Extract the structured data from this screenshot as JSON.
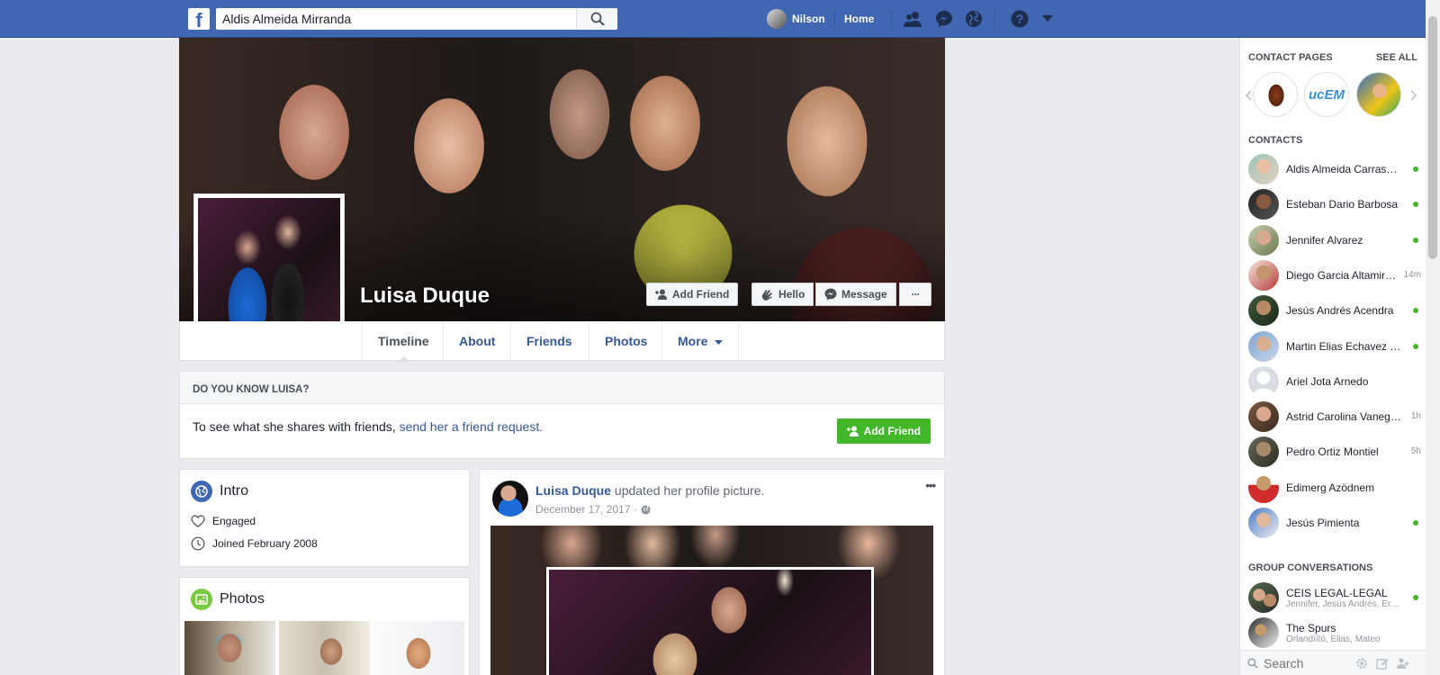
{
  "topbar": {
    "logo": "f",
    "search_value": "Aldis Almeida Mirranda",
    "user_name": "Nilson",
    "home_label": "Home",
    "icons": [
      "friend-requests-icon",
      "messages-icon",
      "notifications-globe-icon",
      "help-icon",
      "caret-down-icon"
    ],
    "brand_color": "#4267b2"
  },
  "profile": {
    "name": "Luisa Duque",
    "add_friend_label": "Add Friend",
    "hello_label": "Hello",
    "message_label": "Message",
    "more_dots": "···"
  },
  "tabs": {
    "timeline": "Timeline",
    "about": "About",
    "friends": "Friends",
    "photos": "Photos",
    "more": "More"
  },
  "know": {
    "heading": "DO YOU KNOW LUISA?",
    "text": "To see what she shares with friends,",
    "link": "send her a friend request.",
    "button": "Add Friend"
  },
  "intro": {
    "title": "Intro",
    "engaged": "Engaged",
    "joined": "Joined February 2008"
  },
  "photos_card": {
    "title": "Photos"
  },
  "post": {
    "author": "Luisa Duque",
    "action": "updated her profile picture.",
    "date": "December 17, 2017 ·",
    "menu": "•••"
  },
  "sidebar": {
    "contact_pages_label": "CONTACT PAGES",
    "see_all": "SEE ALL",
    "pages": [
      "page-1-logo",
      "ucem-logo",
      "page-3-logo"
    ],
    "ucem_text": "ucEM",
    "contacts_label": "CONTACTS",
    "contacts": [
      {
        "name": "Aldis Almeida Carrasquilla",
        "status": "",
        "online": true
      },
      {
        "name": "Esteban Dario Barbosa",
        "status": "",
        "online": true
      },
      {
        "name": "Jennifer Alvarez",
        "status": "",
        "online": true
      },
      {
        "name": "Diego Garcia Altamiranda",
        "status": "14m",
        "online": false
      },
      {
        "name": "Jesús Andrés Acendra",
        "status": "",
        "online": true
      },
      {
        "name": "Martin Elias Echavez Romero",
        "status": "",
        "online": true
      },
      {
        "name": "Ariel Jota Arnedo",
        "status": "",
        "online": false
      },
      {
        "name": "Astrid Carolina Vanegas",
        "status": "1h",
        "online": false
      },
      {
        "name": "Pedro Ortiz Montiel",
        "status": "5h",
        "online": false
      },
      {
        "name": "Edimerg Azödnem",
        "status": "",
        "online": false
      },
      {
        "name": "Jesús Pimienta",
        "status": "",
        "online": true
      }
    ],
    "group_label": "GROUP CONVERSATIONS",
    "groups": [
      {
        "name": "CEIS LEGAL-LEGAL",
        "members": "Jennifer, Jesús Andrés, Ernesto",
        "online": true
      },
      {
        "name": "The Spurs",
        "members": "Órlandíító, Elias, Mateo",
        "online": false
      }
    ],
    "search_placeholder": "Search",
    "online_color": "#42b72a"
  }
}
